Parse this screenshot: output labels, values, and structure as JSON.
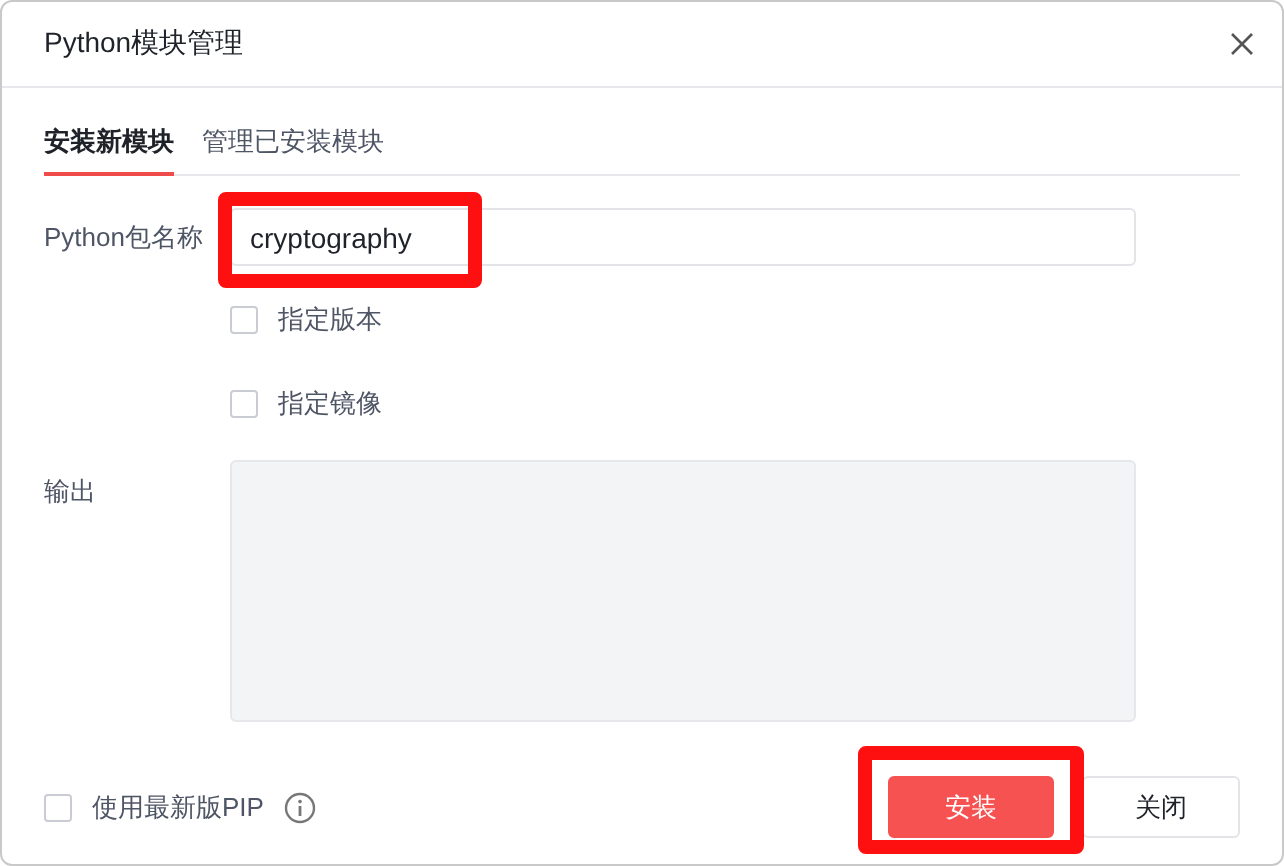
{
  "window": {
    "title": "Python模块管理"
  },
  "tabs": [
    {
      "label": "安装新模块",
      "selected": true
    },
    {
      "label": "管理已安装模块",
      "selected": false
    }
  ],
  "package_field": {
    "label": "Python包名称",
    "value": "cryptography",
    "highlighted": true
  },
  "options": [
    {
      "label": "指定版本",
      "checked": false
    },
    {
      "label": "指定镜像",
      "checked": false
    }
  ],
  "output": {
    "label": "输出"
  },
  "latest_pip": {
    "label": "使用最新版PIP",
    "checked": false
  },
  "buttons": [
    {
      "label": "安装",
      "kind": "primary",
      "highlighted": true
    },
    {
      "label": "关闭",
      "kind": "secondary"
    }
  ]
}
